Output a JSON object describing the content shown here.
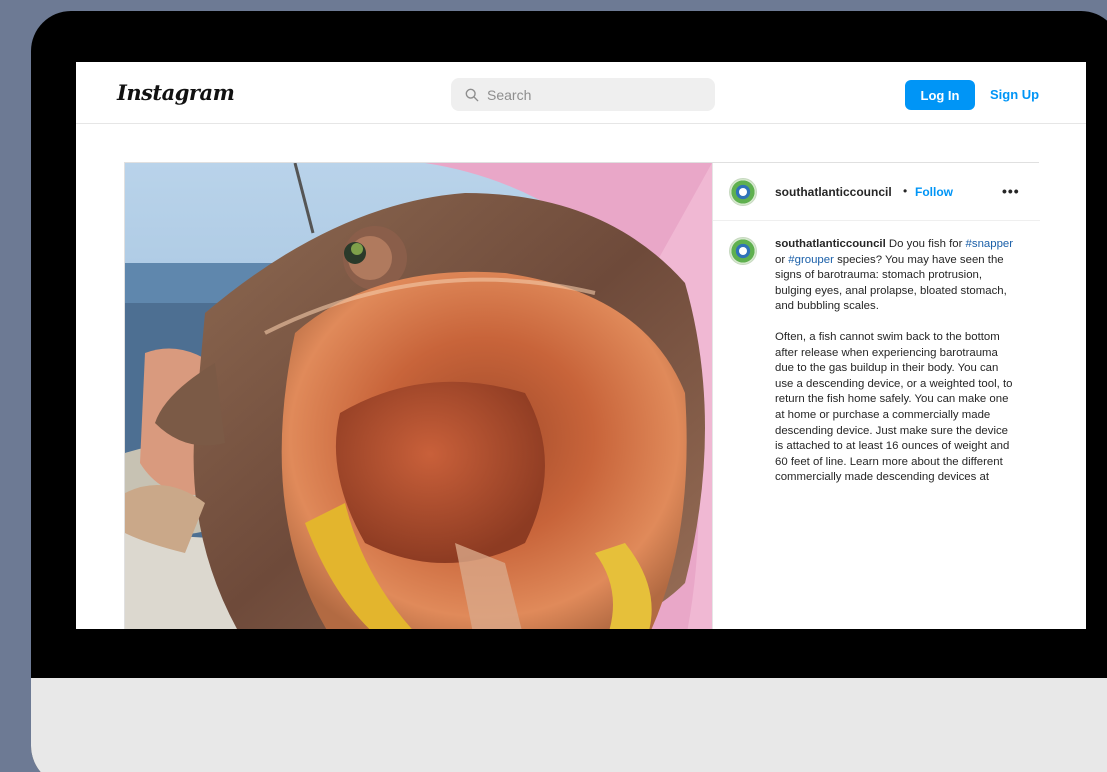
{
  "header": {
    "logo": "Instagram",
    "search_placeholder": "Search",
    "login_label": "Log In",
    "signup_label": "Sign Up"
  },
  "post": {
    "username": "southatlanticcouncil",
    "separator": "•",
    "follow_label": "Follow",
    "more_label": "•••",
    "caption": {
      "username": "southatlanticcouncil",
      "p1_part1": " Do you fish for ",
      "tag1": "#snapper",
      "p1_part2": " or ",
      "tag2": "#grouper",
      "p1_part3": " species? You may have seen the signs of barotrauma: stomach protrusion, bulging eyes, anal prolapse, bloated stomach, and bubbling scales.",
      "p2": "Often, a fish cannot swim back to the bottom after release when experiencing barotrauma due to the gas buildup in their body. You can use a descending device, or a weighted tool, to return the fish home safely. You can make one at home or purchase a commercially made descending device. Just make sure the device is attached to at least 16 ounces of weight and 60 feet of line. Learn more about the different commercially made descending devices at"
    }
  },
  "colors": {
    "accent": "#0095f6",
    "background": "#6d7a94"
  },
  "icons": {
    "search": "search-icon",
    "more": "more-options-icon"
  }
}
